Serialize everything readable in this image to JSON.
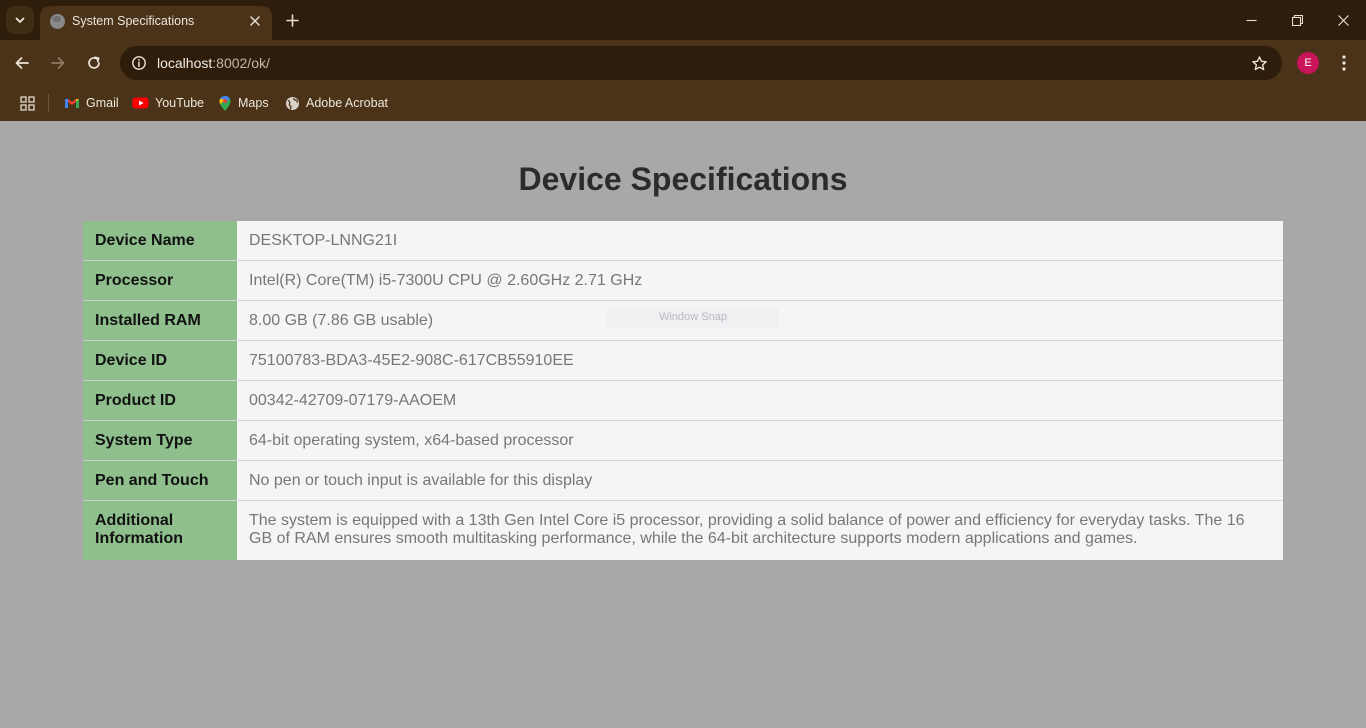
{
  "browser": {
    "tab": {
      "title": "System Specifications"
    },
    "address": {
      "host": "localhost",
      "path": ":8002/ok/"
    },
    "profile_initial": "E",
    "bookmarks": [
      {
        "label": "Gmail",
        "icon": "gmail-icon"
      },
      {
        "label": "YouTube",
        "icon": "youtube-icon"
      },
      {
        "label": "Maps",
        "icon": "maps-icon"
      },
      {
        "label": "Adobe Acrobat",
        "icon": "globe-icon"
      }
    ]
  },
  "page": {
    "title": "Device Specifications",
    "snap_hint": "Window Snap",
    "specs": [
      {
        "label": "Device Name",
        "value": "DESKTOP-LNNG21I"
      },
      {
        "label": "Processor",
        "value": "Intel(R) Core(TM) i5-7300U CPU @ 2.60GHz 2.71 GHz"
      },
      {
        "label": "Installed RAM",
        "value": "8.00 GB (7.86 GB usable)"
      },
      {
        "label": "Device ID",
        "value": "75100783-BDA3-45E2-908C-617CB55910EE"
      },
      {
        "label": "Product ID",
        "value": "00342-42709-07179-AAOEM"
      },
      {
        "label": "System Type",
        "value": "64-bit operating system, x64-based processor"
      },
      {
        "label": "Pen and Touch",
        "value": "No pen or touch input is available for this display"
      },
      {
        "label": "Additional Information",
        "value": "The system is equipped with a 13th Gen Intel Core i5 processor, providing a solid balance of power and efficiency for everyday tasks. The 16 GB of RAM ensures smooth multitasking performance, while the 64-bit architecture supports modern applications and games."
      }
    ]
  },
  "colors": {
    "tabstrip": "#2d1d0a",
    "toolbar": "#4a3319",
    "page_background": "#a8a8a8",
    "label_cell": "#8fbf8d",
    "value_cell": "#f5f5f5",
    "profile_badge": "#c8155a"
  }
}
